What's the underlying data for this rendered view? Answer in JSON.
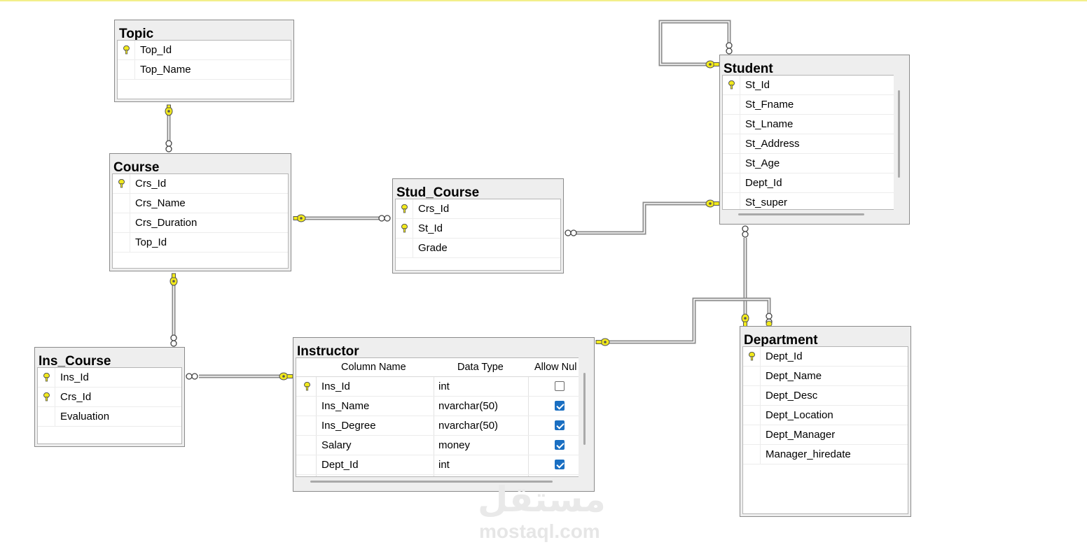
{
  "tables": {
    "topic": {
      "title": "Topic",
      "columns": [
        {
          "name": "Top_Id",
          "pk": true
        },
        {
          "name": "Top_Name",
          "pk": false
        }
      ]
    },
    "course": {
      "title": "Course",
      "columns": [
        {
          "name": "Crs_Id",
          "pk": true
        },
        {
          "name": "Crs_Name",
          "pk": false
        },
        {
          "name": "Crs_Duration",
          "pk": false
        },
        {
          "name": "Top_Id",
          "pk": false
        }
      ]
    },
    "stud_course": {
      "title": "Stud_Course",
      "columns": [
        {
          "name": "Crs_Id",
          "pk": true
        },
        {
          "name": "St_Id",
          "pk": true
        },
        {
          "name": "Grade",
          "pk": false
        }
      ]
    },
    "student": {
      "title": "Student",
      "columns": [
        {
          "name": "St_Id",
          "pk": true
        },
        {
          "name": "St_Fname",
          "pk": false
        },
        {
          "name": "St_Lname",
          "pk": false
        },
        {
          "name": "St_Address",
          "pk": false
        },
        {
          "name": "St_Age",
          "pk": false
        },
        {
          "name": "Dept_Id",
          "pk": false
        },
        {
          "name": "St_super",
          "pk": false
        }
      ]
    },
    "ins_course": {
      "title": "Ins_Course",
      "columns": [
        {
          "name": "Ins_Id",
          "pk": true
        },
        {
          "name": "Crs_Id",
          "pk": true
        },
        {
          "name": "Evaluation",
          "pk": false
        }
      ]
    },
    "instructor": {
      "title": "Instructor",
      "headers": [
        "Column Name",
        "Data Type",
        "Allow Nul"
      ],
      "columns": [
        {
          "name": "Ins_Id",
          "type": "int",
          "pk": true,
          "allow_null": false
        },
        {
          "name": "Ins_Name",
          "type": "nvarchar(50)",
          "pk": false,
          "allow_null": true
        },
        {
          "name": "Ins_Degree",
          "type": "nvarchar(50)",
          "pk": false,
          "allow_null": true
        },
        {
          "name": "Salary",
          "type": "money",
          "pk": false,
          "allow_null": true
        },
        {
          "name": "Dept_Id",
          "type": "int",
          "pk": false,
          "allow_null": true
        }
      ]
    },
    "department": {
      "title": "Department",
      "columns": [
        {
          "name": "Dept_Id",
          "pk": true
        },
        {
          "name": "Dept_Name",
          "pk": false
        },
        {
          "name": "Dept_Desc",
          "pk": false
        },
        {
          "name": "Dept_Location",
          "pk": false
        },
        {
          "name": "Dept_Manager",
          "pk": false
        },
        {
          "name": "Manager_hiredate",
          "pk": false
        }
      ]
    }
  },
  "watermark": {
    "arabic": "مستقل",
    "latin": "mostaql.com"
  },
  "colors": {
    "key_yellow": "#f2ea1c",
    "connector": "#8a8a8a",
    "checkbox_blue": "#1a6fc2"
  }
}
